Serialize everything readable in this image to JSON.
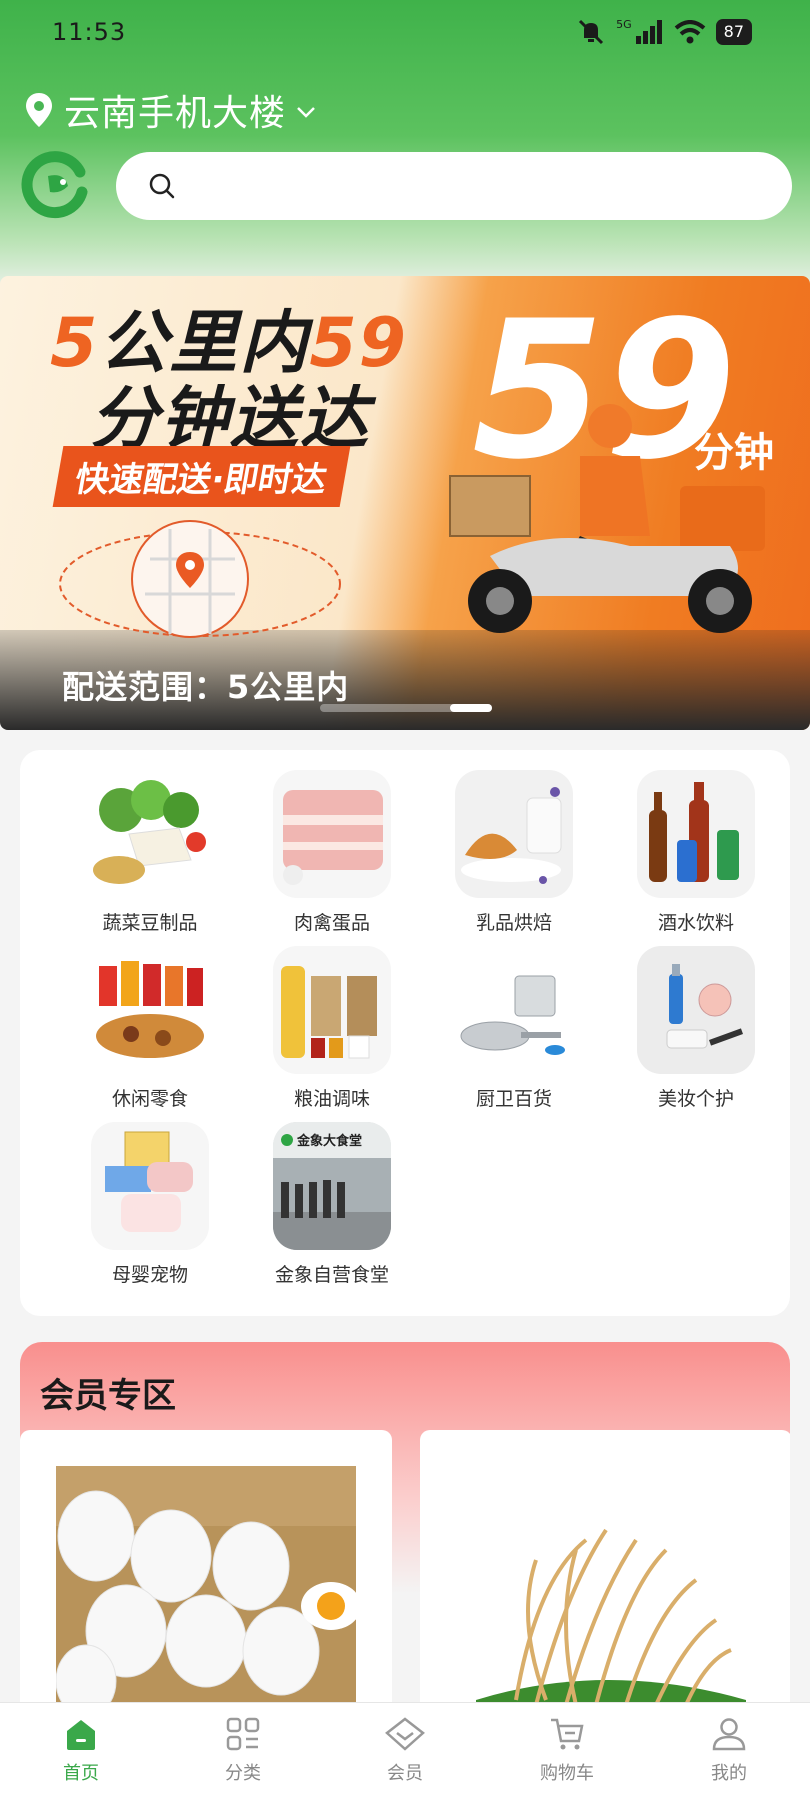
{
  "status": {
    "time": "11:53",
    "network": "5G",
    "battery": "87"
  },
  "location": {
    "name": "云南手机大楼"
  },
  "search": {
    "placeholder": "",
    "value": ""
  },
  "banner": {
    "headline_line1_prefix": "5",
    "headline_line1_mid": "公里内",
    "headline_line1_suffix": "59",
    "headline_line2": "分钟送达",
    "tagline": "快速配送·即时达",
    "big_number": "59",
    "big_unit": "分钟",
    "range_text": "配送范围：5公里内",
    "active_slide": 3,
    "slide_count": 3
  },
  "categories": [
    {
      "label": "蔬菜豆制品",
      "icon": "vegetables-tofu"
    },
    {
      "label": "肉禽蛋品",
      "icon": "pork-meat"
    },
    {
      "label": "乳品烘焙",
      "icon": "croissant-milk"
    },
    {
      "label": "酒水饮料",
      "icon": "bottles-cans"
    },
    {
      "label": "休闲零食",
      "icon": "snacks"
    },
    {
      "label": "粮油调味",
      "icon": "oil-grains"
    },
    {
      "label": "厨卫百货",
      "icon": "cookware"
    },
    {
      "label": "美妆个护",
      "icon": "cosmetics"
    },
    {
      "label": "母婴宠物",
      "icon": "baby-pet"
    },
    {
      "label": "金象自营食堂",
      "icon": "canteen"
    }
  ],
  "canteen_sign": "金象大食堂",
  "member": {
    "title": "会员专区"
  },
  "nav": [
    {
      "label": "首页",
      "icon": "home-icon",
      "active": true
    },
    {
      "label": "分类",
      "icon": "category-icon",
      "active": false
    },
    {
      "label": "会员",
      "icon": "member-icon",
      "active": false
    },
    {
      "label": "购物车",
      "icon": "cart-icon",
      "active": false
    },
    {
      "label": "我的",
      "icon": "profile-icon",
      "active": false
    }
  ],
  "colors": {
    "brand_green": "#3aa84a",
    "accent_orange": "#ee6422",
    "member_pink": "#f98f8d"
  }
}
